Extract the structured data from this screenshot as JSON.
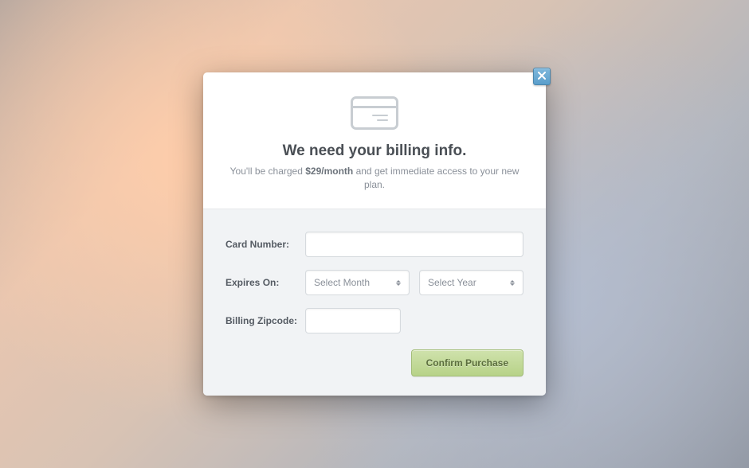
{
  "modal": {
    "title": "We need your billing info.",
    "subtitle_prefix": "You'll be charged ",
    "price": "$29/month",
    "subtitle_suffix": " and get immediate access to your new plan."
  },
  "form": {
    "card_number_label": "Card Number:",
    "expires_label": "Expires On:",
    "zipcode_label": "Billing Zipcode:",
    "month_placeholder": "Select Month",
    "year_placeholder": "Select Year",
    "confirm_label": "Confirm Purchase"
  }
}
